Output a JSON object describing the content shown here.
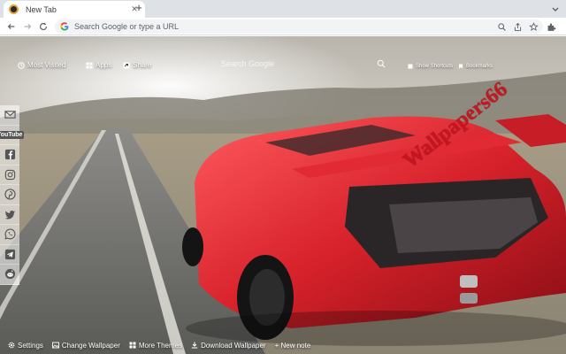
{
  "tab": {
    "title": "New Tab",
    "close_icon": "close-icon",
    "favicon_icon": "lamborghini-logo-icon"
  },
  "toolbar": {
    "omnibox_placeholder": "Search Google or type a URL"
  },
  "newtab": {
    "most_visited_label": "Most Visited",
    "apps_label": "Apps",
    "share_label": "Share",
    "search_placeholder": "Search Google",
    "show_shortcuts_label": "Show Shortcuts",
    "bookmarks_label": "Bookmarks",
    "watermark": "Wallpapers66"
  },
  "social": [
    {
      "name": "gmail-icon"
    },
    {
      "name": "youtube-icon",
      "label": "YouTube"
    },
    {
      "name": "facebook-icon"
    },
    {
      "name": "instagram-icon"
    },
    {
      "name": "pinterest-icon"
    },
    {
      "name": "twitter-icon"
    },
    {
      "name": "whatsapp-icon"
    },
    {
      "name": "telegram-icon"
    },
    {
      "name": "reddit-icon"
    }
  ],
  "bottombar": {
    "settings_label": "Settings",
    "change_wallpaper_label": "Change Wallpaper",
    "more_themes_label": "More Themes",
    "download_wallpaper_label": "Download Wallpaper",
    "new_note_label": "+ New note"
  },
  "colors": {
    "accent_red": "#c4141f",
    "chrome_bg": "#dee1e6",
    "omnibox_bg": "#f1f3f4"
  }
}
